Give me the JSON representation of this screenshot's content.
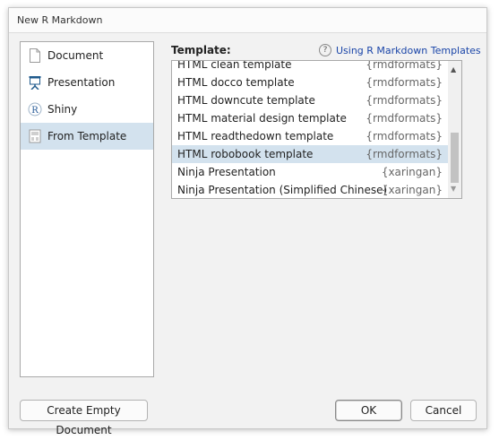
{
  "window": {
    "title": "New R Markdown"
  },
  "sidebar": {
    "items": [
      {
        "label": "Document",
        "icon": "document-icon",
        "selected": false
      },
      {
        "label": "Presentation",
        "icon": "presentation-icon",
        "selected": false
      },
      {
        "label": "Shiny",
        "icon": "shiny-r-icon",
        "selected": false
      },
      {
        "label": "From Template",
        "icon": "template-icon",
        "selected": true
      }
    ]
  },
  "templates": {
    "label": "Template:",
    "help_link": "Using R Markdown Templates",
    "items": [
      {
        "name": "HTML clean template",
        "package": "{rmdformats}"
      },
      {
        "name": "HTML docco template",
        "package": "{rmdformats}"
      },
      {
        "name": "HTML downcute template",
        "package": "{rmdformats}"
      },
      {
        "name": "HTML material design template",
        "package": "{rmdformats}"
      },
      {
        "name": "HTML readthedown template",
        "package": "{rmdformats}"
      },
      {
        "name": "HTML robobook template",
        "package": "{rmdformats}",
        "selected": true
      },
      {
        "name": "Ninja Presentation",
        "package": "{xaringan}"
      },
      {
        "name": "Ninja Presentation (Simplified Chinese)",
        "package": "{xaringan}"
      }
    ]
  },
  "buttons": {
    "create_empty": "Create Empty Document",
    "ok": "OK",
    "cancel": "Cancel"
  },
  "colors": {
    "selection": "#d3e2ee",
    "link": "#1a45a8"
  }
}
